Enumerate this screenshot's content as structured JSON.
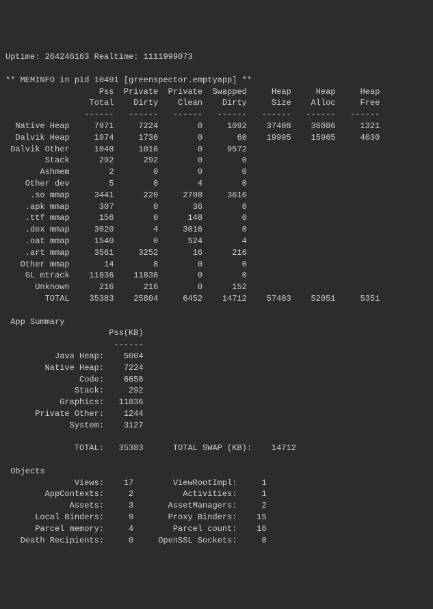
{
  "header": {
    "uptime_label": "Uptime:",
    "uptime_value": "264246163",
    "realtime_label": "Realtime:",
    "realtime_value": "1111999073"
  },
  "meminfo_header": "** MEMINFO in pid 10491 [greenspector.emptyapp] **",
  "columns": {
    "c1a": "Pss",
    "c1b": "Total",
    "c2a": "Private",
    "c2b": "Dirty",
    "c3a": "Private",
    "c3b": "Clean",
    "c4a": "Swapped",
    "c4b": "Dirty",
    "c5a": "Heap",
    "c5b": "Size",
    "c6a": "Heap",
    "c6b": "Alloc",
    "c7a": "Heap",
    "c7b": "Free"
  },
  "dash6": "------",
  "rows": [
    {
      "name": "Native Heap",
      "pss": "7971",
      "pd": "7224",
      "pc": "0",
      "sd": "1092",
      "hs": "37408",
      "ha": "36086",
      "hf": "1321"
    },
    {
      "name": "Dalvik Heap",
      "pss": "1974",
      "pd": "1736",
      "pc": "0",
      "sd": "60",
      "hs": "19995",
      "ha": "15965",
      "hf": "4030"
    },
    {
      "name": "Dalvik Other",
      "pss": "1048",
      "pd": "1016",
      "pc": "0",
      "sd": "9572",
      "hs": "",
      "ha": "",
      "hf": ""
    },
    {
      "name": "Stack",
      "pss": "292",
      "pd": "292",
      "pc": "0",
      "sd": "0",
      "hs": "",
      "ha": "",
      "hf": ""
    },
    {
      "name": "Ashmem",
      "pss": "2",
      "pd": "0",
      "pc": "0",
      "sd": "0",
      "hs": "",
      "ha": "",
      "hf": ""
    },
    {
      "name": "Other dev",
      "pss": "5",
      "pd": "0",
      "pc": "4",
      "sd": "0",
      "hs": "",
      "ha": "",
      "hf": ""
    },
    {
      "name": ".so mmap",
      "pss": "3441",
      "pd": "220",
      "pc": "2708",
      "sd": "3616",
      "hs": "",
      "ha": "",
      "hf": ""
    },
    {
      "name": ".apk mmap",
      "pss": "307",
      "pd": "0",
      "pc": "36",
      "sd": "0",
      "hs": "",
      "ha": "",
      "hf": ""
    },
    {
      "name": ".ttf mmap",
      "pss": "156",
      "pd": "0",
      "pc": "148",
      "sd": "0",
      "hs": "",
      "ha": "",
      "hf": ""
    },
    {
      "name": ".dex mmap",
      "pss": "3020",
      "pd": "4",
      "pc": "3016",
      "sd": "0",
      "hs": "",
      "ha": "",
      "hf": ""
    },
    {
      "name": ".oat mmap",
      "pss": "1540",
      "pd": "0",
      "pc": "524",
      "sd": "4",
      "hs": "",
      "ha": "",
      "hf": ""
    },
    {
      "name": ".art mmap",
      "pss": "3561",
      "pd": "3252",
      "pc": "16",
      "sd": "216",
      "hs": "",
      "ha": "",
      "hf": ""
    },
    {
      "name": "Other mmap",
      "pss": "14",
      "pd": "8",
      "pc": "0",
      "sd": "0",
      "hs": "",
      "ha": "",
      "hf": ""
    },
    {
      "name": "GL mtrack",
      "pss": "11836",
      "pd": "11836",
      "pc": "0",
      "sd": "0",
      "hs": "",
      "ha": "",
      "hf": ""
    },
    {
      "name": "Unknown",
      "pss": "216",
      "pd": "216",
      "pc": "0",
      "sd": "152",
      "hs": "",
      "ha": "",
      "hf": ""
    }
  ],
  "total_row": {
    "name": "TOTAL",
    "pss": "35383",
    "pd": "25804",
    "pc": "6452",
    "sd": "14712",
    "hs": "57403",
    "ha": "52051",
    "hf": "5351"
  },
  "app_summary": {
    "title": "App Summary",
    "col": "Pss(KB)",
    "rows": [
      {
        "name": "Java Heap:",
        "val": "5004"
      },
      {
        "name": "Native Heap:",
        "val": "7224"
      },
      {
        "name": "Code:",
        "val": "6656"
      },
      {
        "name": "Stack:",
        "val": "292"
      },
      {
        "name": "Graphics:",
        "val": "11836"
      },
      {
        "name": "Private Other:",
        "val": "1244"
      },
      {
        "name": "System:",
        "val": "3127"
      }
    ],
    "total_label": "TOTAL:",
    "total_val": "35383",
    "swap_label": "TOTAL SWAP (KB):",
    "swap_val": "14712"
  },
  "objects": {
    "title": "Objects",
    "rows": [
      {
        "l": "Views:",
        "lv": "17",
        "r": "ViewRootImpl:",
        "rv": "1"
      },
      {
        "l": "AppContexts:",
        "lv": "2",
        "r": "Activities:",
        "rv": "1"
      },
      {
        "l": "Assets:",
        "lv": "3",
        "r": "AssetManagers:",
        "rv": "2"
      },
      {
        "l": "Local Binders:",
        "lv": "9",
        "r": "Proxy Binders:",
        "rv": "15"
      },
      {
        "l": "Parcel memory:",
        "lv": "4",
        "r": "Parcel count:",
        "rv": "16"
      },
      {
        "l": "Death Recipients:",
        "lv": "0",
        "r": "OpenSSL Sockets:",
        "rv": "0"
      }
    ]
  }
}
